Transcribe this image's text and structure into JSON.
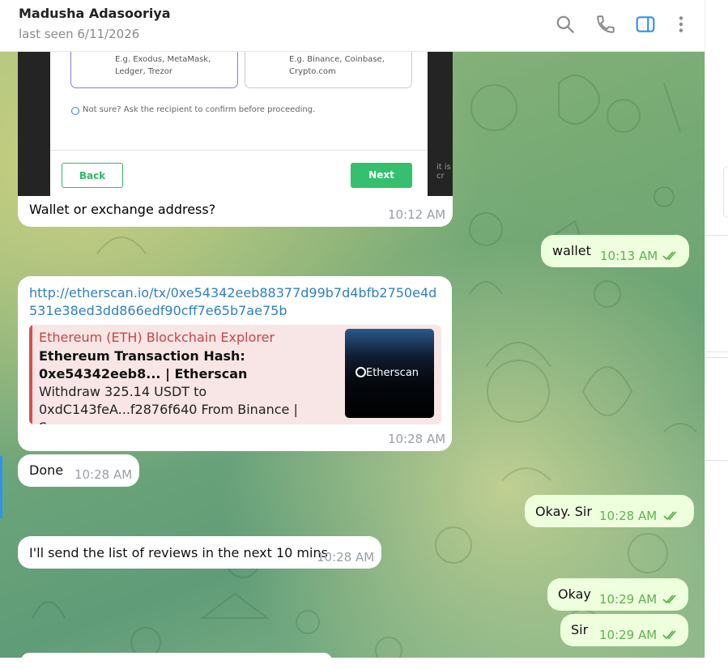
{
  "header": {
    "name": "Madusha Adasooriya",
    "status": "last seen 6/11/2026",
    "icons": [
      "search-icon",
      "phone-icon",
      "sidebar-toggle-icon",
      "more-vertical-icon"
    ],
    "accent_color": "#3390ec"
  },
  "screenshot": {
    "card1_line1": "E.g. Exodus, MetaMask,",
    "card1_line2": "Ledger, Trezor",
    "card2_line1": "E.g. Binance, Coinbase,",
    "card2_line2": "Crypto.com",
    "note": "Not sure? Ask the recipient to confirm before proceeding.",
    "back_label": "Back",
    "next_label": "Next",
    "cut_text": "it is cr"
  },
  "messages": [
    {
      "text": "Wallet or exchange address?",
      "time": "10:12 AM",
      "dir": "in"
    },
    {
      "text": "wallet",
      "time": "10:13 AM",
      "dir": "out"
    },
    {
      "text": "http://etherscan.io/tx/0xe54342eeb88377d99b7d4bfb2750e4d531e38ed3dd866edf90cff7e65b7ae75b",
      "time": "10:28 AM",
      "dir": "in"
    },
    {
      "text": "Done",
      "time": "10:28 AM",
      "dir": "in"
    },
    {
      "text": "Okay. Sir",
      "time": "10:28 AM",
      "dir": "out"
    },
    {
      "text": "I'll send the list of reviews in the next 10 mins",
      "time": "10:28 AM",
      "dir": "in"
    },
    {
      "text": "Okay",
      "time": "10:29 AM",
      "dir": "out"
    },
    {
      "text": "Sir",
      "time": "10:29 AM",
      "dir": "out"
    }
  ],
  "link_preview": {
    "site": "Ethereum (ETH) Blockchain Explorer",
    "title": "Ethereum Transaction Hash: 0xe54342eeb8... | Etherscan",
    "description": "Withdraw 325.14 USDT to 0xdC143feA...f2876f640 From Binance | Succes...",
    "image_text": "Etherscan"
  }
}
